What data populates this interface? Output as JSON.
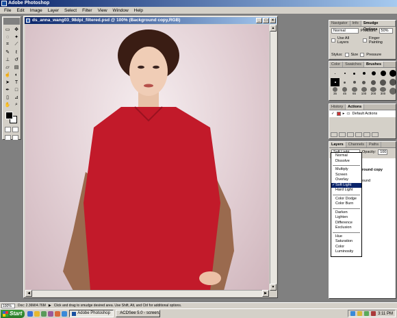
{
  "app": {
    "title": "Adobe Photoshop"
  },
  "menu": [
    "File",
    "Edit",
    "Image",
    "Layer",
    "Select",
    "Filter",
    "View",
    "Window",
    "Help"
  ],
  "document": {
    "title": "ds_anna_wang03_98dpi_filtered.psd @ 100% (Background copy,RGB)"
  },
  "smudge_palette": {
    "tabs": [
      "Navigator",
      "Info",
      "Smudge Options"
    ],
    "mode": "Normal",
    "pressure_label": "Pressure:",
    "pressure": "50%",
    "use_all_layers": "Use All Layers",
    "finger_painting": "Finger Painting",
    "stylus_label": "Stylus:",
    "size": "Size",
    "pressure_opt": "Pressure"
  },
  "brushes_palette": {
    "tabs": [
      "Color",
      "Swatches",
      "Brushes"
    ],
    "labels": [
      "",
      "",
      "",
      "",
      "",
      "",
      "",
      "",
      "",
      "",
      "",
      "",
      "",
      "",
      "35",
      "45",
      "65",
      "100",
      "200",
      "300",
      ""
    ]
  },
  "actions_palette": {
    "tabs": [
      "History",
      "Actions"
    ],
    "item": "Default Actions"
  },
  "layers_palette": {
    "tabs": [
      "Layers",
      "Channels",
      "Paths"
    ],
    "blend_mode": "Soft Light",
    "opacity_label": "Opacity:",
    "opacity": "100",
    "layer_name_1": "round copy",
    "layer_name_2": "ound"
  },
  "blend_menu": {
    "group1": [
      "Normal",
      "Dissolve"
    ],
    "group2": [
      "Multiply",
      "Screen",
      "Overlay",
      "Soft Light",
      "Hard Light"
    ],
    "group3": [
      "Color Dodge",
      "Color Burn"
    ],
    "group4": [
      "Darken",
      "Lighten",
      "Difference",
      "Exclusion"
    ],
    "group5": [
      "Hue",
      "Saturation",
      "Color",
      "Luminosity"
    ],
    "selected": "Soft Light"
  },
  "status": {
    "zoom": "100%",
    "doc": "Doc: 2.36M/4.76M",
    "hint": "Click and drag to smudge desired area. Use Shift, Alt, and Ctrl for additional options."
  },
  "taskbar": {
    "start": "Start",
    "tasks": [
      "Adobe Photoshop",
      "ACDSee 5.0 - screen..."
    ],
    "clock": "3:11 PM"
  }
}
